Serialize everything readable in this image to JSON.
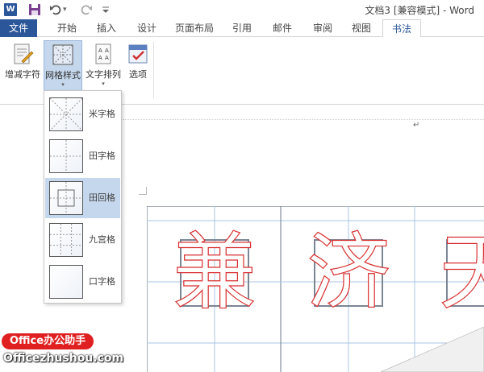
{
  "window": {
    "title": "文档3 [兼容模式] - Word",
    "app_icon": "word-logo",
    "app_letter": "W"
  },
  "quick_access": {
    "save_icon": "save-icon",
    "undo_icon": "undo-icon",
    "undo_dropdown": "▾",
    "redo_icon": "redo-icon",
    "customize_icon": "customize-qat-icon"
  },
  "tabs": [
    {
      "label": "文件"
    },
    {
      "label": "开始"
    },
    {
      "label": "插入"
    },
    {
      "label": "设计"
    },
    {
      "label": "页面布局"
    },
    {
      "label": "引用"
    },
    {
      "label": "邮件"
    },
    {
      "label": "审阅"
    },
    {
      "label": "视图"
    },
    {
      "label": "书法"
    }
  ],
  "ribbon": {
    "buttons": [
      {
        "label": "增减字符",
        "icon": "add-remove-chars-icon"
      },
      {
        "label": "网格样式",
        "icon": "grid-style-icon",
        "arrow": "▾"
      },
      {
        "label": "文字排列",
        "icon": "text-arrange-icon",
        "arrow": "▾"
      },
      {
        "label": "选项",
        "icon": "options-icon"
      }
    ]
  },
  "dropdown": {
    "items": [
      {
        "label": "米字格",
        "icon": "mi-grid-icon"
      },
      {
        "label": "田字格",
        "icon": "tian-grid-icon"
      },
      {
        "label": "田回格",
        "icon": "tian-hui-grid-icon"
      },
      {
        "label": "九宫格",
        "icon": "nine-grid-icon"
      },
      {
        "label": "口字格",
        "icon": "kou-grid-icon"
      }
    ],
    "selected_index": 2
  },
  "document": {
    "paragraph_mark": "↵",
    "characters": [
      "兼",
      "济",
      "天"
    ]
  },
  "watermark": {
    "badge": "Office办公助手",
    "url": "Officezhushou.com"
  },
  "colors": {
    "accent": "#2b579a",
    "selected": "#c5d7ec",
    "grid_line": "#a9c4e4",
    "char_outline": "#d93030",
    "box_border": "#7a8694",
    "watermark_red": "#e02020"
  }
}
